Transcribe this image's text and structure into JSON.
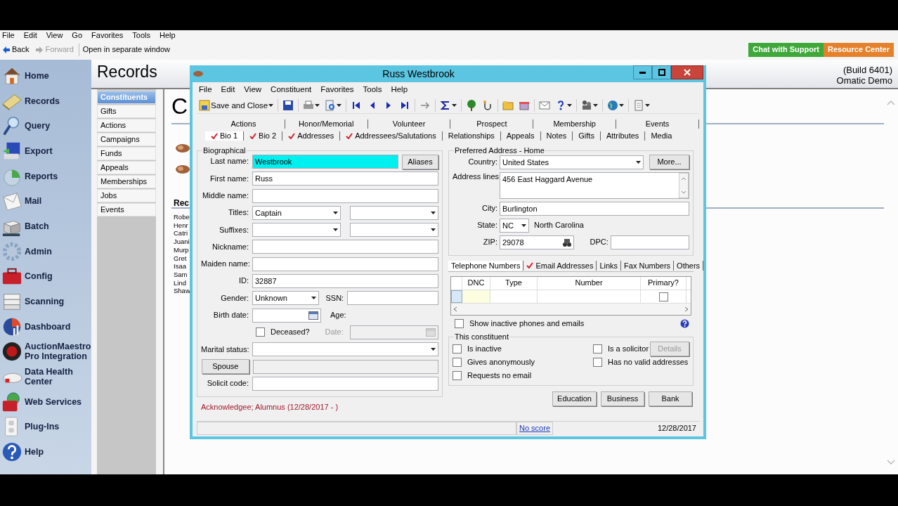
{
  "menu": [
    "File",
    "Edit",
    "View",
    "Go",
    "Favorites",
    "Tools",
    "Help"
  ],
  "nav_toolbar": [
    {
      "label": "Back",
      "disabled": false
    },
    {
      "label": "Forward",
      "disabled": true
    },
    {
      "label": "Open in separate window",
      "disabled": false
    }
  ],
  "header_buttons": [
    {
      "label": "Chat with Support",
      "color": "#3ea83a"
    },
    {
      "label": "Resource Center",
      "color": "#e5812b"
    }
  ],
  "sidebar": {
    "items": [
      {
        "label": "Home"
      },
      {
        "label": "Records"
      },
      {
        "label": "Query"
      },
      {
        "label": "Export"
      },
      {
        "label": "Reports"
      },
      {
        "label": "Mail"
      },
      {
        "label": "Batch"
      },
      {
        "label": "Admin"
      },
      {
        "label": "Config"
      },
      {
        "label": "Scanning"
      },
      {
        "label": "Dashboard"
      },
      {
        "label": "AuctionMaestro Pro Integration"
      },
      {
        "label": "Data Health Center"
      },
      {
        "label": "Web Services"
      },
      {
        "label": "Plug-Ins"
      },
      {
        "label": "Help"
      }
    ]
  },
  "records": {
    "title": "Records",
    "build": "(Build 6401)",
    "company": "Omatic Demo",
    "categories": [
      {
        "label": "Constituents",
        "selected": true
      },
      {
        "label": "Gifts",
        "selected": false
      },
      {
        "label": "Actions",
        "selected": false
      },
      {
        "label": "Campaigns",
        "selected": false
      },
      {
        "label": "Funds",
        "selected": false
      },
      {
        "label": "Appeals",
        "selected": false
      },
      {
        "label": "Memberships",
        "selected": false
      },
      {
        "label": "Jobs",
        "selected": false
      },
      {
        "label": "Events",
        "selected": false
      }
    ],
    "content_title": "C",
    "section_title": "Rec",
    "names": [
      "Robe",
      "Henr",
      "Catri",
      "Juani",
      "Murp",
      "Gret",
      "Isaa",
      "Sam",
      "Lind",
      "Shaw"
    ]
  },
  "dialog": {
    "title": "Russ Westbrook",
    "menu": [
      "File",
      "Edit",
      "View",
      "Constituent",
      "Favorites",
      "Tools",
      "Help"
    ],
    "save_button": "Save and Close",
    "tabs_row1": [
      {
        "label": "Actions",
        "selected": false
      },
      {
        "label": "Honor/Memorial",
        "selected": false
      },
      {
        "label": "Volunteer",
        "selected": false
      },
      {
        "label": "Prospect",
        "selected": false
      },
      {
        "label": "Membership",
        "selected": false
      },
      {
        "label": "Events",
        "selected": false
      }
    ],
    "tabs_row2": [
      {
        "label": "Bio 1",
        "checked": true,
        "selected": true
      },
      {
        "label": "Bio 2",
        "checked": true,
        "selected": false
      },
      {
        "label": "Addresses",
        "checked": true,
        "selected": false
      },
      {
        "label": "Addressees/Salutations",
        "checked": true,
        "selected": false
      },
      {
        "label": "Relationships",
        "checked": false,
        "selected": false
      },
      {
        "label": "Appeals",
        "checked": false,
        "selected": false
      },
      {
        "label": "Notes",
        "checked": false,
        "selected": false
      },
      {
        "label": "Gifts",
        "checked": false,
        "selected": false
      },
      {
        "label": "Attributes",
        "checked": false,
        "selected": false
      },
      {
        "label": "Media",
        "checked": false,
        "selected": false
      }
    ],
    "biographical": {
      "legend": "Biographical",
      "rows": [
        {
          "kind": "text",
          "label": "Last name:",
          "value": "Westbrook",
          "highlighted": true,
          "button": "Aliases"
        },
        {
          "kind": "text",
          "label": "First name:",
          "value": "Russ"
        },
        {
          "kind": "text",
          "label": "Middle name:"
        },
        {
          "kind": "combo2",
          "label": "Titles:",
          "value": "Captain"
        },
        {
          "kind": "combo2",
          "label": "Suffixes:"
        },
        {
          "kind": "text",
          "label": "Nickname:"
        },
        {
          "kind": "text",
          "label": "Maiden name:"
        },
        {
          "kind": "text",
          "label": "ID:",
          "value": "32887"
        },
        {
          "kind": "gender",
          "label": "Gender:",
          "value": "Unknown",
          "extra_label": "SSN:"
        },
        {
          "kind": "date",
          "label": "Birth date:",
          "extra_label": "Age:"
        },
        {
          "kind": "check",
          "label": "Deceased?",
          "checked": false,
          "extra_label": "Date:",
          "date_disabled": true
        },
        {
          "kind": "combo",
          "label": "Marital status:"
        },
        {
          "kind": "button",
          "label": "Spouse"
        },
        {
          "kind": "text",
          "label": "Solicit code:"
        }
      ]
    },
    "constituent_codes": "Acknowledgee; Alumnus (12/28/2017 - )",
    "address": {
      "legend": "Preferred Address - Home",
      "rows": [
        {
          "kind": "country",
          "label": "Country:",
          "value": "United States",
          "button": "More..."
        },
        {
          "kind": "multiline",
          "label": "Address lines:",
          "value": "456 East Haggard Avenue"
        },
        {
          "kind": "text",
          "label": "City:",
          "value": "Burlington"
        },
        {
          "kind": "state",
          "label": "State:",
          "value": "NC",
          "state_name": "North Carolina"
        },
        {
          "kind": "zip",
          "label": "ZIP:",
          "value": "29078",
          "extra_label": "DPC:"
        }
      ]
    },
    "contact_tabs": [
      {
        "label": "Telephone Numbers",
        "checked": false,
        "selected": true
      },
      {
        "label": "Email Addresses",
        "checked": true,
        "selected": false
      },
      {
        "label": "Links",
        "checked": false,
        "selected": false
      },
      {
        "label": "Fax Numbers",
        "checked": false,
        "selected": false
      },
      {
        "label": "Others",
        "checked": false,
        "selected": false
      }
    ],
    "grid": {
      "columns": [
        "DNC",
        "Type",
        "Number",
        "Primary?"
      ],
      "rows": [
        {
          "primary": false
        }
      ]
    },
    "show_inactive": {
      "label": "Show inactive phones and emails",
      "checked": false
    },
    "constituent": {
      "legend": "This constituent",
      "checks": [
        {
          "label": "Is inactive",
          "checked": false
        },
        {
          "label": "Gives anonymously",
          "checked": false
        },
        {
          "label": "Requests no email",
          "checked": false
        },
        {
          "label": "Is a solicitor",
          "checked": false
        },
        {
          "label": "Has no valid addresses",
          "checked": false
        }
      ],
      "details_button": {
        "label": "Details",
        "disabled": true
      }
    },
    "buttons": [
      "Education",
      "Business",
      "Bank"
    ],
    "status_bar": {
      "score_link": "No score",
      "date": "12/28/2017"
    }
  }
}
